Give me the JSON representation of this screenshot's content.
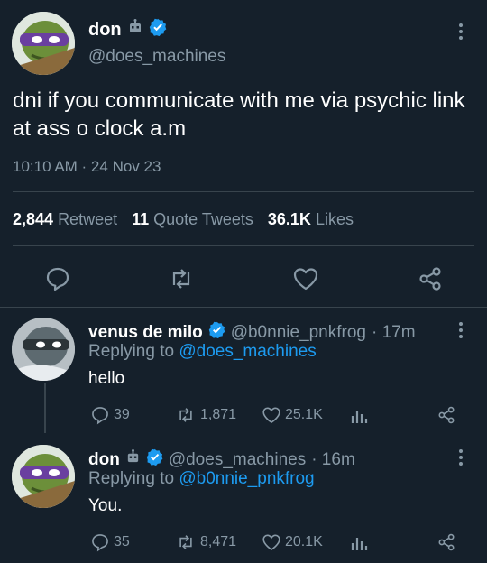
{
  "main_tweet": {
    "name": "don",
    "handle": "@does_machines",
    "text": "dni if you communicate with me via psychic link at ass o clock a.m",
    "timestamp": "10:10 AM · 24 Nov 23",
    "stats": {
      "retweets_count": "2,844",
      "retweets_label": "Retweet",
      "quotes_count": "11",
      "quotes_label": "Quote Tweets",
      "likes_count": "36.1K",
      "likes_label": "Likes"
    },
    "icons": [
      "reply-icon",
      "retweet-icon",
      "like-icon",
      "share-icon"
    ]
  },
  "replies": [
    {
      "name": "venus de milo",
      "handle": "@b0nnie_pnkfrog",
      "time": "· 17m",
      "replying_prefix": "Replying to",
      "replying_to": "@does_machines",
      "text": "hello",
      "replies": "39",
      "retweets": "1,871",
      "likes": "25.1K"
    },
    {
      "name": "don",
      "handle": "@does_machines",
      "time": "· 16m",
      "replying_prefix": "Replying to",
      "replying_to": "@b0nnie_pnkfrog",
      "text": "You.",
      "replies": "35",
      "retweets": "8,471",
      "likes": "20.1K"
    }
  ],
  "colors": {
    "background": "#15202b",
    "text": "#ffffff",
    "muted": "#8899a6",
    "link": "#1d9bf0",
    "verified": "#1d9bf0",
    "divider": "#38444d"
  }
}
